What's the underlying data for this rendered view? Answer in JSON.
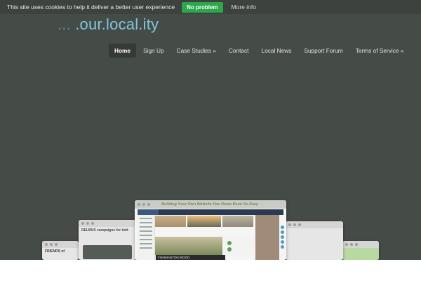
{
  "cookie": {
    "message": "This site uses cookies to help it deliver a better user experience",
    "accept_label": "No problem",
    "more_label": "More info"
  },
  "logo": {
    "dots": "... ",
    "main": ".our.local.ity"
  },
  "nav": [
    {
      "label": "Home",
      "active": true
    },
    {
      "label": "Sign Up"
    },
    {
      "label": "Case Studies »"
    },
    {
      "label": "Contact"
    },
    {
      "label": "Local News"
    },
    {
      "label": "Support Forum"
    },
    {
      "label": "Terms of Service »"
    }
  ],
  "showcase": {
    "main_tagline": "Building Your Own Website Has Never Been So Easy",
    "main_caption": "FISHMANTON WOOD",
    "left1_heading": "RELBUS campaigns for bett",
    "left2_heading": "FRIENDS of"
  },
  "colors": {
    "background": "#454b47",
    "cookie_button": "#2aa84a",
    "logo_accent": "#7fc7d9"
  }
}
